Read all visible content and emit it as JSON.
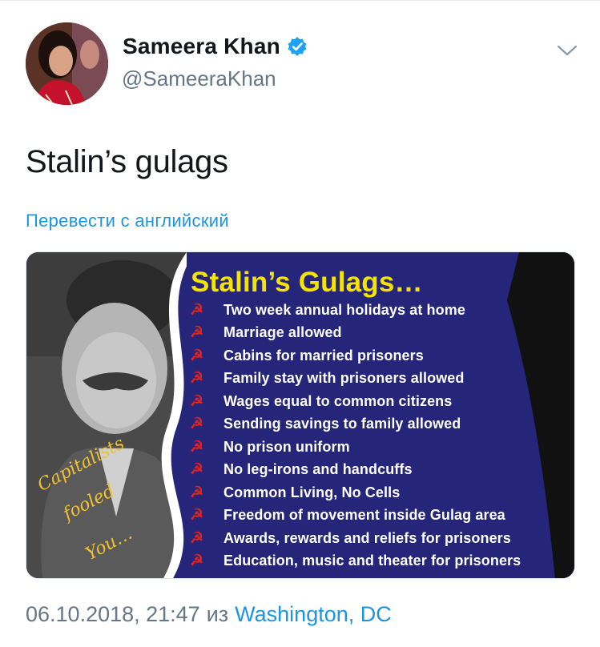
{
  "colors": {
    "accent": "#1b95e0",
    "secondary_text": "#657786",
    "media_bg": "#25257a",
    "title_yellow": "#f5e400",
    "hammer_red": "#e4211d"
  },
  "author": {
    "display_name": "Sameera Khan",
    "handle": "@SameeraKhan",
    "verified_icon": "verified-badge-icon"
  },
  "menu_icon": "chevron-down-icon",
  "tweet": {
    "text": "Stalin’s gulags",
    "translate_label": "Перевести с английский"
  },
  "media": {
    "title": "Stalin’s Gulags…",
    "bullet_symbol": "☭",
    "items": [
      "Two week annual holidays at home",
      "Marriage allowed",
      "Cabins for married prisoners",
      "Family stay with prisoners allowed",
      "Wages equal to common citizens",
      "Sending savings to family allowed",
      "No prison uniform",
      "No leg-irons and handcuffs",
      "Common Living, No Cells",
      "Freedom of movement inside Gulag area",
      "Awards, rewards and reliefs for prisoners",
      "Education, music and theater for prisoners"
    ],
    "slogan_words": [
      "Capitalists",
      "fooled",
      "You…"
    ]
  },
  "footer": {
    "timestamp": "06.10.2018, 21:47",
    "from_label": "из",
    "location": "Washington, DC"
  }
}
